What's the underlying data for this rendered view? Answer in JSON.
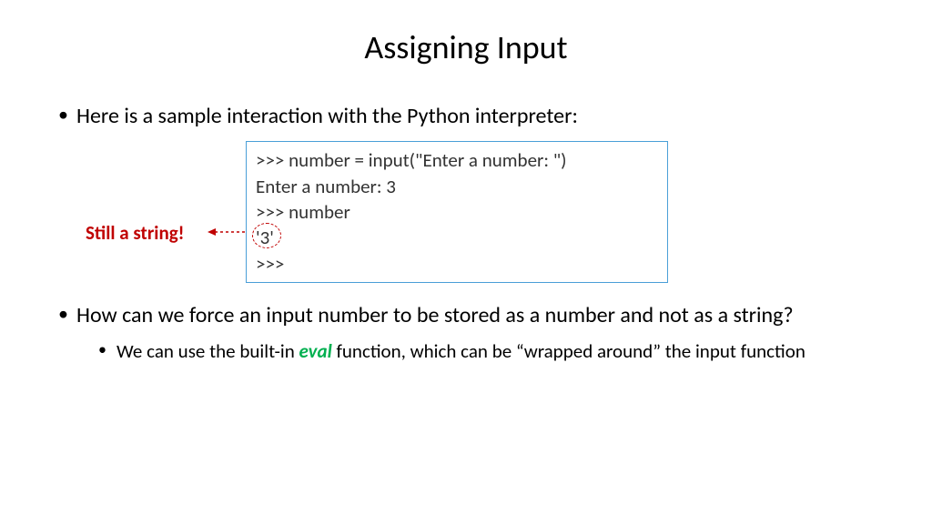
{
  "title": "Assigning Input",
  "bullet1": "Here is a sample interaction with the Python interpreter:",
  "code": {
    "l1": ">>> number = input(\"Enter a number: \")",
    "l2": "Enter a number: 3",
    "l3": ">>> number",
    "l4": "'3'",
    "l5": ">>>"
  },
  "callout": "Still a string!",
  "bullet2": "How can we force an input number to be stored as a number and not as a string?",
  "sub_pre": "We can use the built-in ",
  "sub_eval": "eval",
  "sub_post": " function, which can be “wrapped around” the input function"
}
